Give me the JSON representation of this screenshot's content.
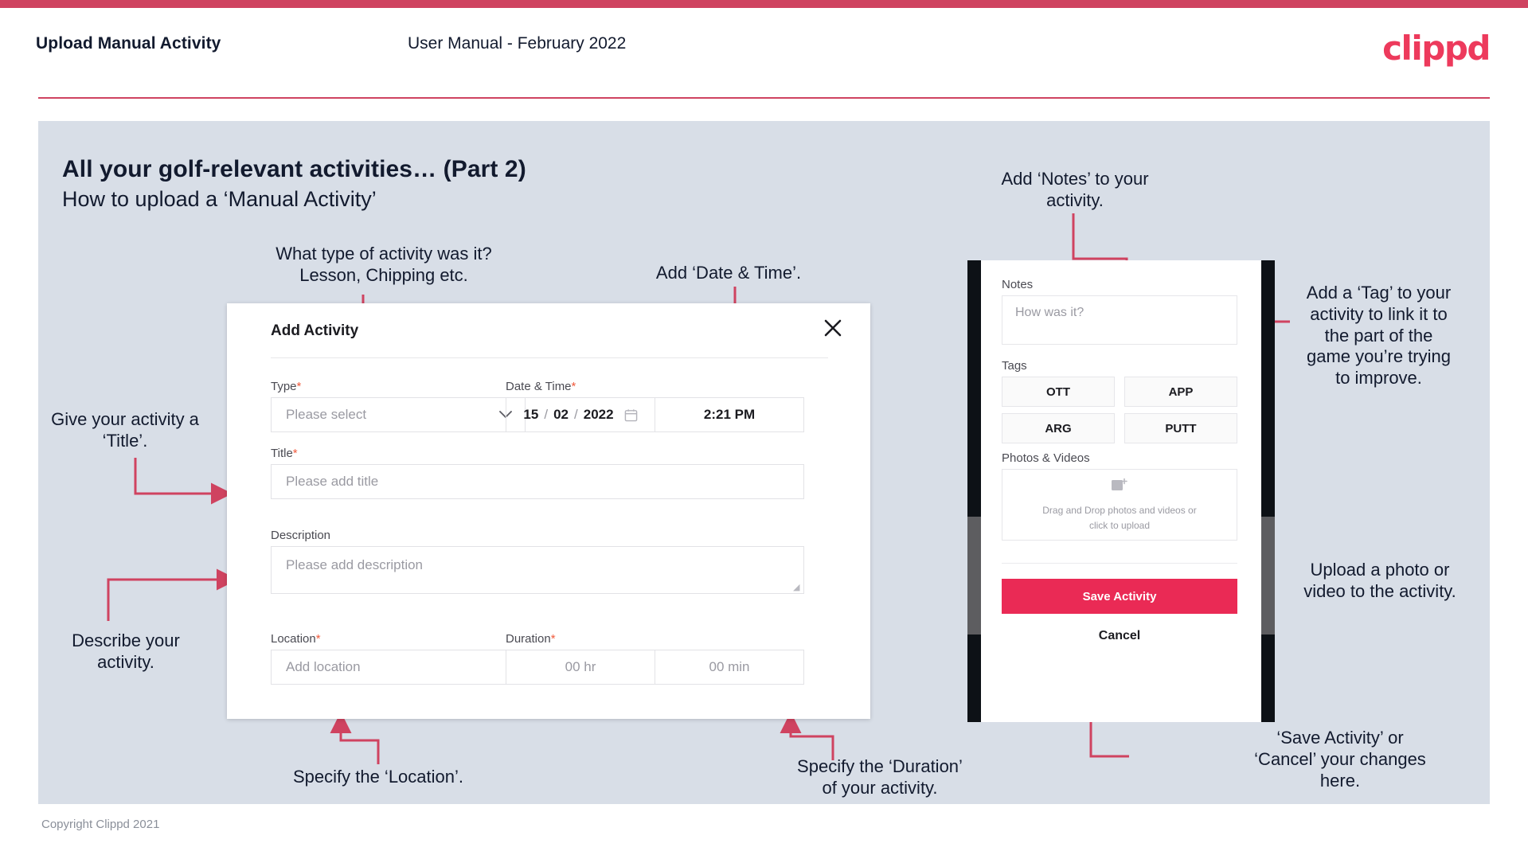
{
  "header": {
    "title": "Upload Manual Activity",
    "subtitle": "User Manual - February 2022",
    "logo": "clippd"
  },
  "slide": {
    "title": "All your golf-relevant activities… (Part 2)",
    "subtitle": "How to upload a ‘Manual Activity’",
    "copyright": "Copyright Clippd 2021"
  },
  "dialog": {
    "title": "Add Activity",
    "close_icon": "close-icon",
    "fields": {
      "type": {
        "label": "Type",
        "required": "*",
        "placeholder": "Please select"
      },
      "datetime": {
        "label": "Date & Time",
        "required": "*",
        "day": "15",
        "month": "02",
        "year": "2022",
        "sep": "/",
        "time": "2:21 PM"
      },
      "title": {
        "label": "Title",
        "required": "*",
        "placeholder": "Please add title"
      },
      "description": {
        "label": "Description",
        "placeholder": "Please add description"
      },
      "location": {
        "label": "Location",
        "required": "*",
        "placeholder": "Add location"
      },
      "duration": {
        "label": "Duration",
        "required": "*",
        "hours": "00 hr",
        "minutes": "00 min"
      }
    }
  },
  "phone": {
    "notes": {
      "label": "Notes",
      "placeholder": "How was it?"
    },
    "tags": {
      "label": "Tags",
      "items": [
        "OTT",
        "APP",
        "ARG",
        "PUTT"
      ]
    },
    "photos": {
      "label": "Photos & Videos",
      "dropzone_line1": "Drag and Drop photos and videos or",
      "dropzone_line2": "click to upload",
      "icon": "add-image-icon"
    },
    "save_label": "Save Activity",
    "cancel_label": "Cancel"
  },
  "annotations": {
    "type": "What type of activity was it?\nLesson, Chipping etc.",
    "datetime": "Add ‘Date & Time’.",
    "title": "Give your activity a\n‘Title’.",
    "description": "Describe your\nactivity.",
    "location": "Specify the ‘Location’.",
    "duration": "Specify the ‘Duration’\nof your activity.",
    "notes": "Add ‘Notes’ to your\nactivity.",
    "tags": "Add a ‘Tag’ to your\nactivity to link it to\nthe part of the\ngame you’re trying\nto improve.",
    "photos": "Upload a photo or\nvideo to the activity.",
    "save": "‘Save Activity’ or\n‘Cancel’ your changes\nhere."
  },
  "colors": {
    "brand": "#cf4360",
    "logo": "#ed3a5c",
    "accent": "#ea2a55",
    "panel": "#d8dee7",
    "ink": "#121a2e",
    "annotation_line": "#cf4360"
  }
}
